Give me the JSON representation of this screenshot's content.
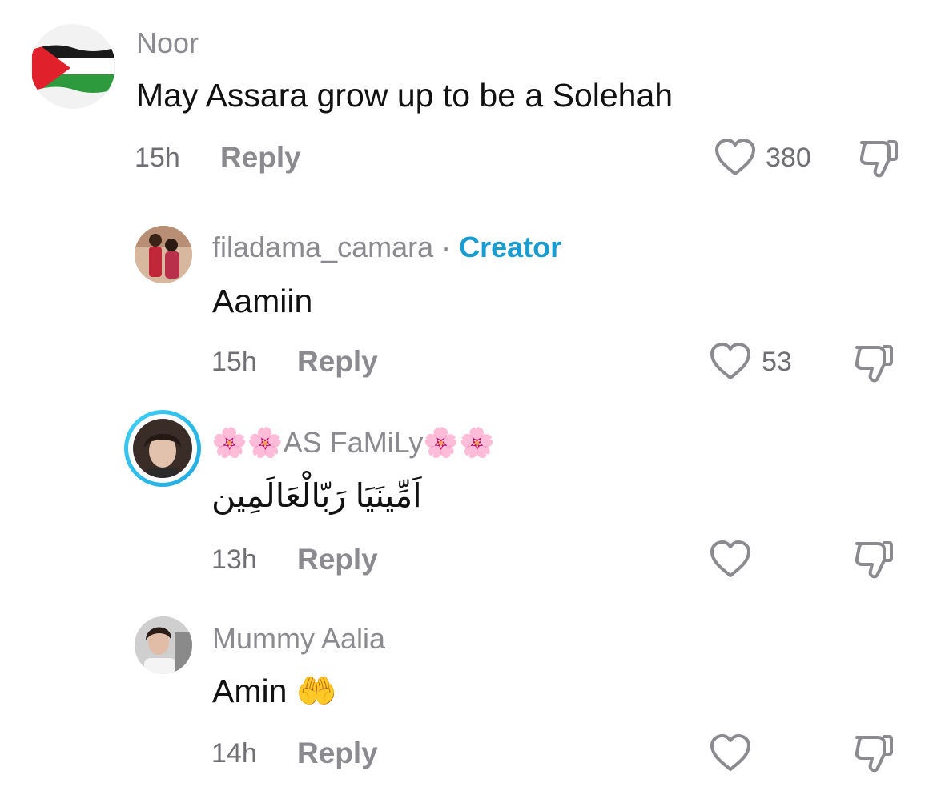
{
  "comments": [
    {
      "username": "Noor",
      "text": "May Assara grow up to be a Solehah",
      "time": "15h",
      "reply_label": "Reply",
      "likes": "380"
    },
    {
      "username": "filadama_camara",
      "separator": " · ",
      "badge": "Creator",
      "text": "Aamiin",
      "time": "15h",
      "reply_label": "Reply",
      "likes": "53"
    },
    {
      "username_prefix": "🌸🌸",
      "username": "AS FaMiLy",
      "username_suffix": "🌸🌸",
      "text": "اَمِّينَيَا رَبّالْعَالَمِين",
      "time": "13h",
      "reply_label": "Reply",
      "likes": ""
    },
    {
      "username": "Mummy Aalia",
      "text": "Amin",
      "emoji": "🤲",
      "time": "14h",
      "reply_label": "Reply",
      "likes": ""
    }
  ],
  "icons": {
    "like": "heart-outline-icon",
    "dislike": "thumbs-down-outline-icon"
  },
  "colors": {
    "creator_badge": "#1b9cd0",
    "story_ring_start": "#33c6f0",
    "story_ring_end": "#2bb3e6",
    "muted_text": "#8a8a8f"
  }
}
